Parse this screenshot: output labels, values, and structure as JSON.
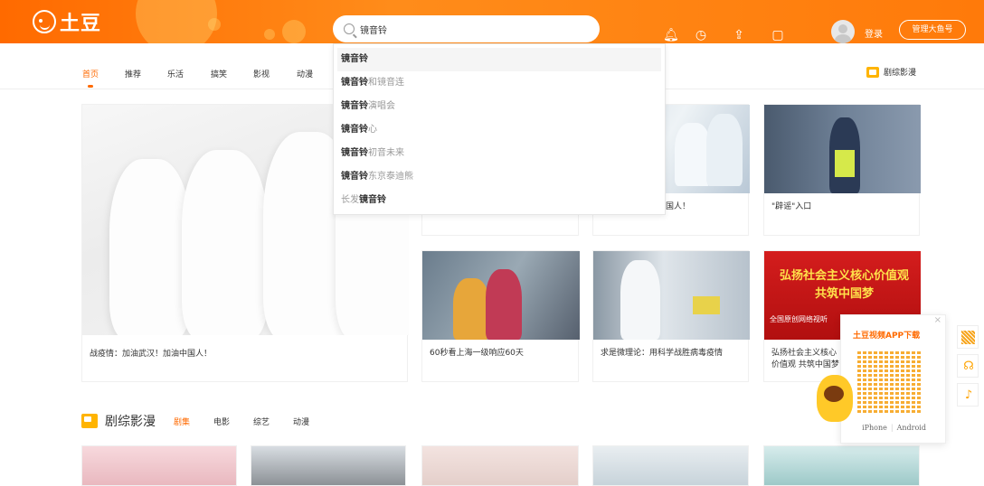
{
  "header": {
    "logo_text": "土豆",
    "search": {
      "value": "镜音铃",
      "placeholder": ""
    },
    "icons": [
      "bell-icon",
      "history-icon",
      "upload-icon",
      "tablet-icon"
    ],
    "login_label": "登录",
    "fish_button_label": "管理大鱼号"
  },
  "nav": {
    "items": [
      {
        "label": "首页",
        "active": true
      },
      {
        "label": "推荐",
        "active": false
      },
      {
        "label": "乐活",
        "active": false
      },
      {
        "label": "搞笑",
        "active": false
      },
      {
        "label": "影视",
        "active": false
      },
      {
        "label": "动漫",
        "active": false
      }
    ],
    "right_label": "剧综影漫"
  },
  "suggestions": [
    {
      "bold": "镜音铃",
      "rest": "",
      "prefix": ""
    },
    {
      "bold": "镜音铃",
      "rest": "和镜音连",
      "prefix": ""
    },
    {
      "bold": "镜音铃",
      "rest": "演唱会",
      "prefix": ""
    },
    {
      "bold": "镜音铃",
      "rest": "心",
      "prefix": ""
    },
    {
      "bold": "镜音铃",
      "rest": "初音未来",
      "prefix": ""
    },
    {
      "bold": "镜音铃",
      "rest": "东京泰迪熊",
      "prefix": ""
    },
    {
      "bold": "镜音铃",
      "rest": "",
      "prefix": "长发"
    }
  ],
  "cards": {
    "hero_caption": "战疫情：加油武汉！加油中国人！",
    "top_right_1_caption": "加油武汉！加油中国人！",
    "top_right_2_caption": "\"辟谣\"入口",
    "mid_1_caption": "60秒看上海一级响应60天",
    "mid_2_caption": "求是微理论：用科学战胜病毒疫情",
    "mid_3_caption": "弘扬社会主义核心价值观 共筑中国梦",
    "mid_3_overlay_line1": "弘扬社会主义核心价值观",
    "mid_3_overlay_line2": "共筑中国梦",
    "mid_3_overlay_line3": "全国原创网络视听"
  },
  "section": {
    "title": "剧综影漫",
    "tabs": [
      {
        "label": "剧集",
        "active": true
      },
      {
        "label": "电影",
        "active": false
      },
      {
        "label": "综艺",
        "active": false
      },
      {
        "label": "动漫",
        "active": false
      }
    ]
  },
  "qr_panel": {
    "title": "土豆视频APP下载",
    "close": "×",
    "iphone": "iPhone",
    "android": "Android"
  },
  "colors": {
    "brand": "#ff6a00",
    "accent_yellow": "#ffb400"
  }
}
